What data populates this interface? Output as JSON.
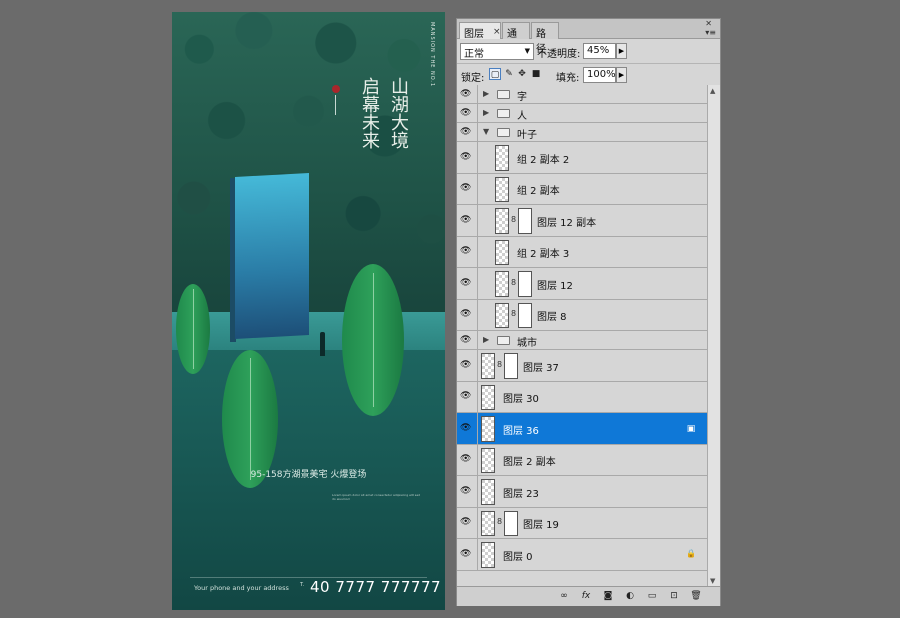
{
  "poster": {
    "brand": "MANSION THE NO.1",
    "headline_col1": "山湖大境",
    "headline_col2": "启幕未来",
    "tagline": "95-158方湖景美宅  火爆登场",
    "small_text": "Lorem ipsum dolor sit amet consectetur adipiscing elit sed do eiusmod",
    "address": "Your phone and your address",
    "phone_label": "T.",
    "phone": "40 7777 777777"
  },
  "panel": {
    "tabs": [
      "图层",
      "通道",
      "路径"
    ],
    "close_glyph": "×",
    "blend_mode": "正常",
    "opacity_label": "不透明度:",
    "opacity_value": "45%",
    "lock_label": "锁定:",
    "fill_label": "填充:",
    "fill_value": "100%",
    "layers": [
      {
        "name": "字",
        "kind": "group",
        "indent": 0,
        "expanded": false
      },
      {
        "name": "人",
        "kind": "group",
        "indent": 0,
        "expanded": false
      },
      {
        "name": "叶子",
        "kind": "group",
        "indent": 0,
        "expanded": true
      },
      {
        "name": "组 2 副本 2",
        "kind": "layer",
        "indent": 1,
        "mask": false
      },
      {
        "name": "组 2 副本",
        "kind": "layer",
        "indent": 1,
        "mask": false
      },
      {
        "name": "图层 12 副本",
        "kind": "layer",
        "indent": 1,
        "mask": true
      },
      {
        "name": "组 2 副本 3",
        "kind": "layer",
        "indent": 1,
        "mask": false
      },
      {
        "name": "图层 12",
        "kind": "layer",
        "indent": 1,
        "mask": true
      },
      {
        "name": "图层 8",
        "kind": "layer",
        "indent": 1,
        "mask": true
      },
      {
        "name": "城市",
        "kind": "group",
        "indent": 0,
        "expanded": false
      },
      {
        "name": "图层 37",
        "kind": "layer",
        "indent": 0,
        "mask": true
      },
      {
        "name": "图层 30",
        "kind": "layer",
        "indent": 0,
        "mask": false
      },
      {
        "name": "图层 36",
        "kind": "layer",
        "indent": 0,
        "mask": false,
        "selected": true
      },
      {
        "name": "图层 2 副本",
        "kind": "layer",
        "indent": 0,
        "mask": false
      },
      {
        "name": "图层 23",
        "kind": "layer",
        "indent": 0,
        "mask": false
      },
      {
        "name": "图层 19",
        "kind": "layer",
        "indent": 0,
        "mask": true
      },
      {
        "name": "图层 0",
        "kind": "layer",
        "indent": 0,
        "mask": false,
        "locked": true
      }
    ],
    "bottom_icons": [
      "link-icon",
      "fx-icon",
      "mask-icon",
      "adjustment-icon",
      "group-icon",
      "new-layer-icon",
      "trash-icon"
    ],
    "colors": {
      "selected": "#0f78d7",
      "panel_bg": "#d6d6d6"
    }
  }
}
